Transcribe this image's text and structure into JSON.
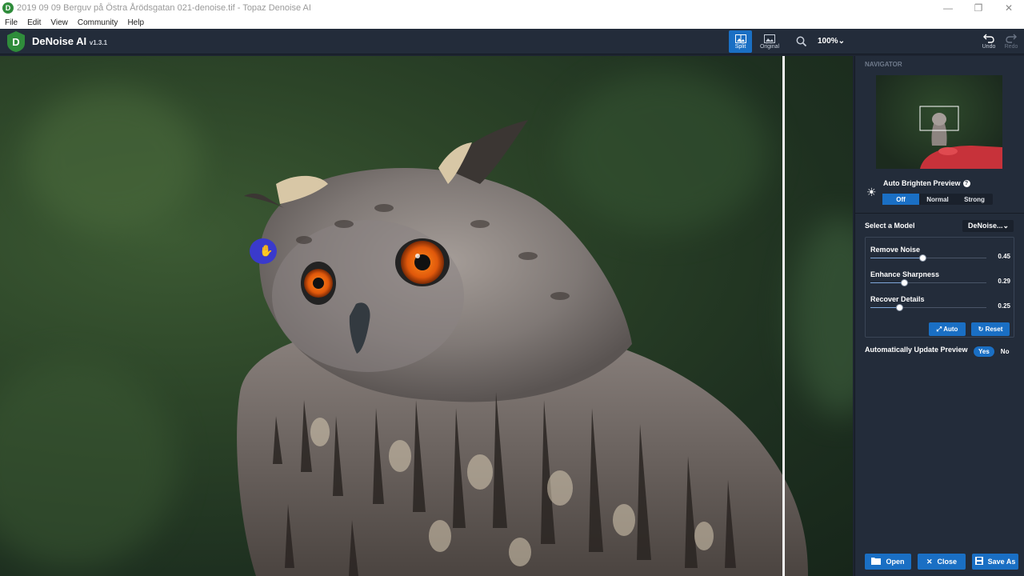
{
  "window": {
    "title": "2019 09 09 Berguv på Östra Årödsgatan 021-denoise.tif - Topaz Denoise AI",
    "min": "—",
    "max": "❐",
    "close": "✕"
  },
  "menu": [
    "File",
    "Edit",
    "View",
    "Community",
    "Help"
  ],
  "toolbar": {
    "app_name": "DeNoise AI",
    "version": "v1.3.1",
    "split_label": "Split",
    "original_label": "Original",
    "zoom_value": "100%",
    "undo_label": "Undo",
    "redo_label": "Redo"
  },
  "navigator": {
    "label": "NAVIGATOR"
  },
  "auto_brighten": {
    "title": "Auto Brighten Preview",
    "options": [
      "Off",
      "Normal",
      "Strong"
    ],
    "selected": "Off"
  },
  "model": {
    "label": "Select a Model",
    "value": "DeNoise..."
  },
  "sliders": [
    {
      "label": "Remove Noise",
      "value": "0.45",
      "level": 0.45
    },
    {
      "label": "Enhance Sharpness",
      "value": "0.29",
      "level": 0.29
    },
    {
      "label": "Recover Details",
      "value": "0.25",
      "level": 0.25
    }
  ],
  "buttons": {
    "auto": "Auto",
    "reset": "Reset"
  },
  "auto_update": {
    "label": "Automatically Update Preview",
    "yes": "Yes",
    "no": "No"
  },
  "footer": {
    "open": "Open",
    "close": "Close",
    "save_as": "Save As"
  },
  "colors": {
    "accent": "#1a6fc4",
    "panel": "#232c3a"
  }
}
